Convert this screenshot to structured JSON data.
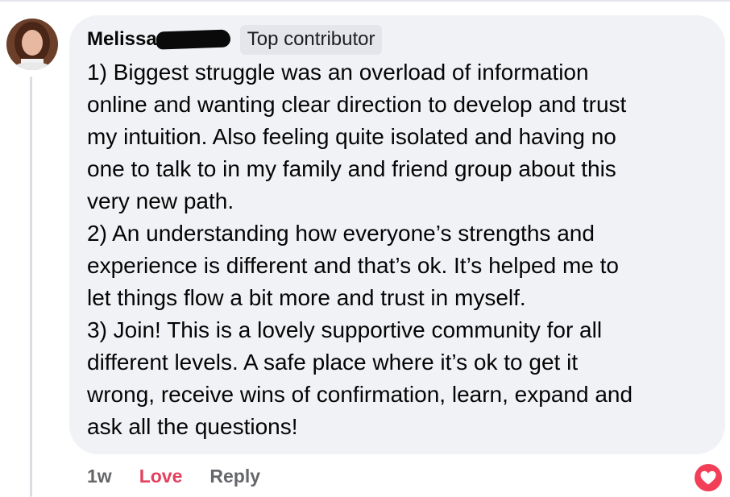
{
  "comment": {
    "author_name": "Melissa",
    "badge": "Top contributor",
    "body_lines": [
      "1) Biggest struggle was an overload of information",
      "online and wanting clear direction to develop and trust",
      "my intuition. Also feeling quite isolated and having no",
      "one to talk to in my family and friend group about this",
      "very new path.",
      "2) An understanding how everyone’s strengths and",
      "experience is different and that’s ok. It’s helped me to",
      "let things flow a bit more and trust in myself.",
      "3) Join! This is a lovely supportive community for all",
      "different levels. A safe place where it’s ok to get it",
      "wrong, receive wins of confirmation, learn, expand and",
      "ask all the questions!"
    ]
  },
  "actions": {
    "timestamp": "1w",
    "love_label": "Love",
    "reply_label": "Reply"
  },
  "reaction": {
    "icon": "love-reaction-icon",
    "color": "#f33e58"
  },
  "colors": {
    "bubble": "#f0f2f5",
    "badge_bg": "#e4e6eb",
    "love_text": "#e4405f",
    "muted_text": "#65676b"
  }
}
